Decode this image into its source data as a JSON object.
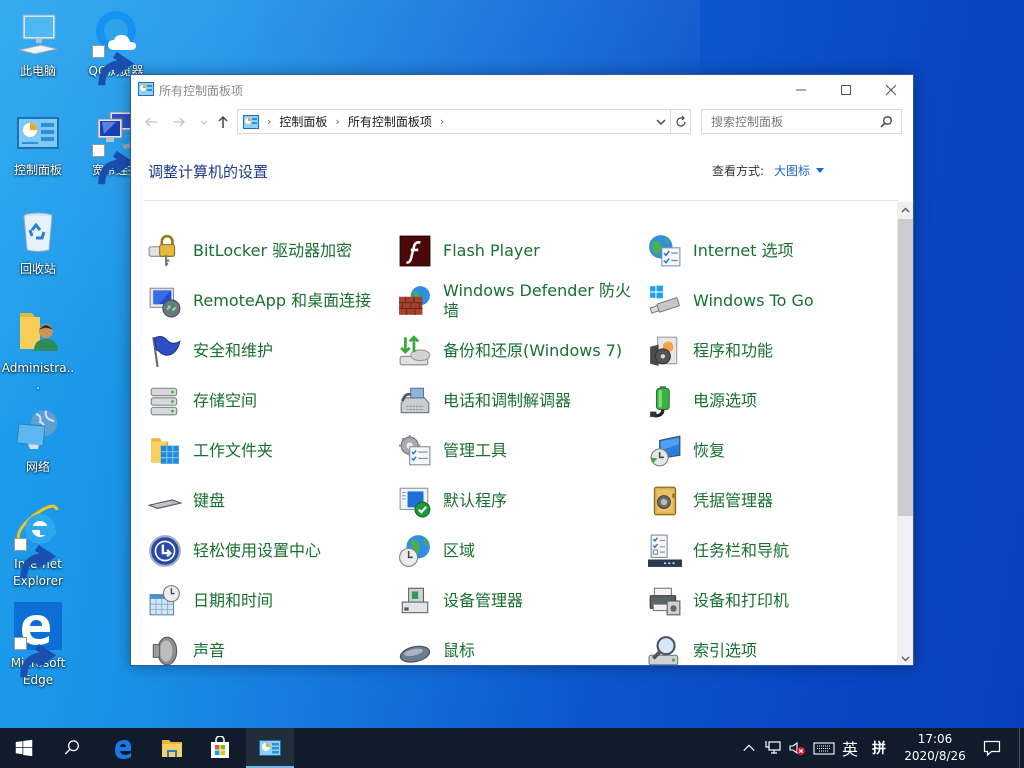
{
  "desktop": {
    "icons": [
      {
        "label": "此电脑",
        "icon": "this-pc-icon",
        "shortcut": false
      },
      {
        "label": "QQ浏览器",
        "icon": "qq-browser-icon",
        "shortcut": true
      },
      {
        "label": "控制面板",
        "icon": "control-panel-icon",
        "shortcut": false
      },
      {
        "label": "宽带连接",
        "icon": "broadband-connection-icon",
        "shortcut": true
      },
      {
        "label": "回收站",
        "icon": "recycle-bin-icon",
        "shortcut": false
      },
      {
        "label": "Administra...",
        "icon": "user-folder-icon",
        "shortcut": false
      },
      {
        "label": "网络",
        "icon": "network-icon",
        "shortcut": false
      },
      {
        "label": "Internet Explorer",
        "icon": "internet-explorer-icon",
        "shortcut": true
      },
      {
        "label": "Microsoft Edge",
        "icon": "edge-icon",
        "shortcut": true
      }
    ]
  },
  "window": {
    "title": "所有控制面板项",
    "breadcrumb": [
      "控制面板",
      "所有控制面板项"
    ],
    "search_placeholder": "搜索控制面板",
    "heading": "调整计算机的设置",
    "view_by_label": "查看方式:",
    "view_by_value": "大图标",
    "scroll_position": 0,
    "items": [
      {
        "label": "BitLocker 驱动器加密",
        "icon": "bitlocker-icon"
      },
      {
        "label": "Flash Player",
        "icon": "flash-player-icon"
      },
      {
        "label": "Internet 选项",
        "icon": "internet-options-icon"
      },
      {
        "label": "RemoteApp 和桌面连接",
        "icon": "remoteapp-icon"
      },
      {
        "label": "Windows Defender 防火墙",
        "icon": "firewall-icon"
      },
      {
        "label": "Windows To Go",
        "icon": "windows-to-go-icon"
      },
      {
        "label": "安全和维护",
        "icon": "security-flag-icon"
      },
      {
        "label": "备份和还原(Windows 7)",
        "icon": "backup-restore-icon"
      },
      {
        "label": "程序和功能",
        "icon": "programs-features-icon"
      },
      {
        "label": "存储空间",
        "icon": "storage-spaces-icon"
      },
      {
        "label": "电话和调制解调器",
        "icon": "phone-modem-icon"
      },
      {
        "label": "电源选项",
        "icon": "power-options-icon"
      },
      {
        "label": "工作文件夹",
        "icon": "work-folders-icon"
      },
      {
        "label": "管理工具",
        "icon": "admin-tools-icon"
      },
      {
        "label": "恢复",
        "icon": "recovery-icon"
      },
      {
        "label": "键盘",
        "icon": "keyboard-icon"
      },
      {
        "label": "默认程序",
        "icon": "default-programs-icon"
      },
      {
        "label": "凭据管理器",
        "icon": "credential-manager-icon"
      },
      {
        "label": "轻松使用设置中心",
        "icon": "ease-of-access-icon"
      },
      {
        "label": "区域",
        "icon": "region-icon"
      },
      {
        "label": "任务栏和导航",
        "icon": "taskbar-navigation-icon"
      },
      {
        "label": "日期和时间",
        "icon": "date-time-icon"
      },
      {
        "label": "设备管理器",
        "icon": "device-manager-icon"
      },
      {
        "label": "设备和打印机",
        "icon": "devices-printers-icon"
      },
      {
        "label": "声音",
        "icon": "sound-icon"
      },
      {
        "label": "鼠标",
        "icon": "mouse-icon"
      },
      {
        "label": "索引选项",
        "icon": "indexing-options-icon"
      }
    ]
  },
  "taskbar": {
    "pinned": [
      "start-icon",
      "search-icon",
      "edge-icon",
      "file-explorer-icon",
      "store-icon",
      "control-panel-icon"
    ],
    "active_app": "control-panel-icon",
    "ime_language": "英",
    "ime_mode": "拼",
    "time": "17:06",
    "date": "2020/8/26"
  },
  "colors": {
    "item_link": "#17702f",
    "heading": "#1e3a8a",
    "accent": "#1a64c8",
    "taskbar": "#101c2c"
  }
}
